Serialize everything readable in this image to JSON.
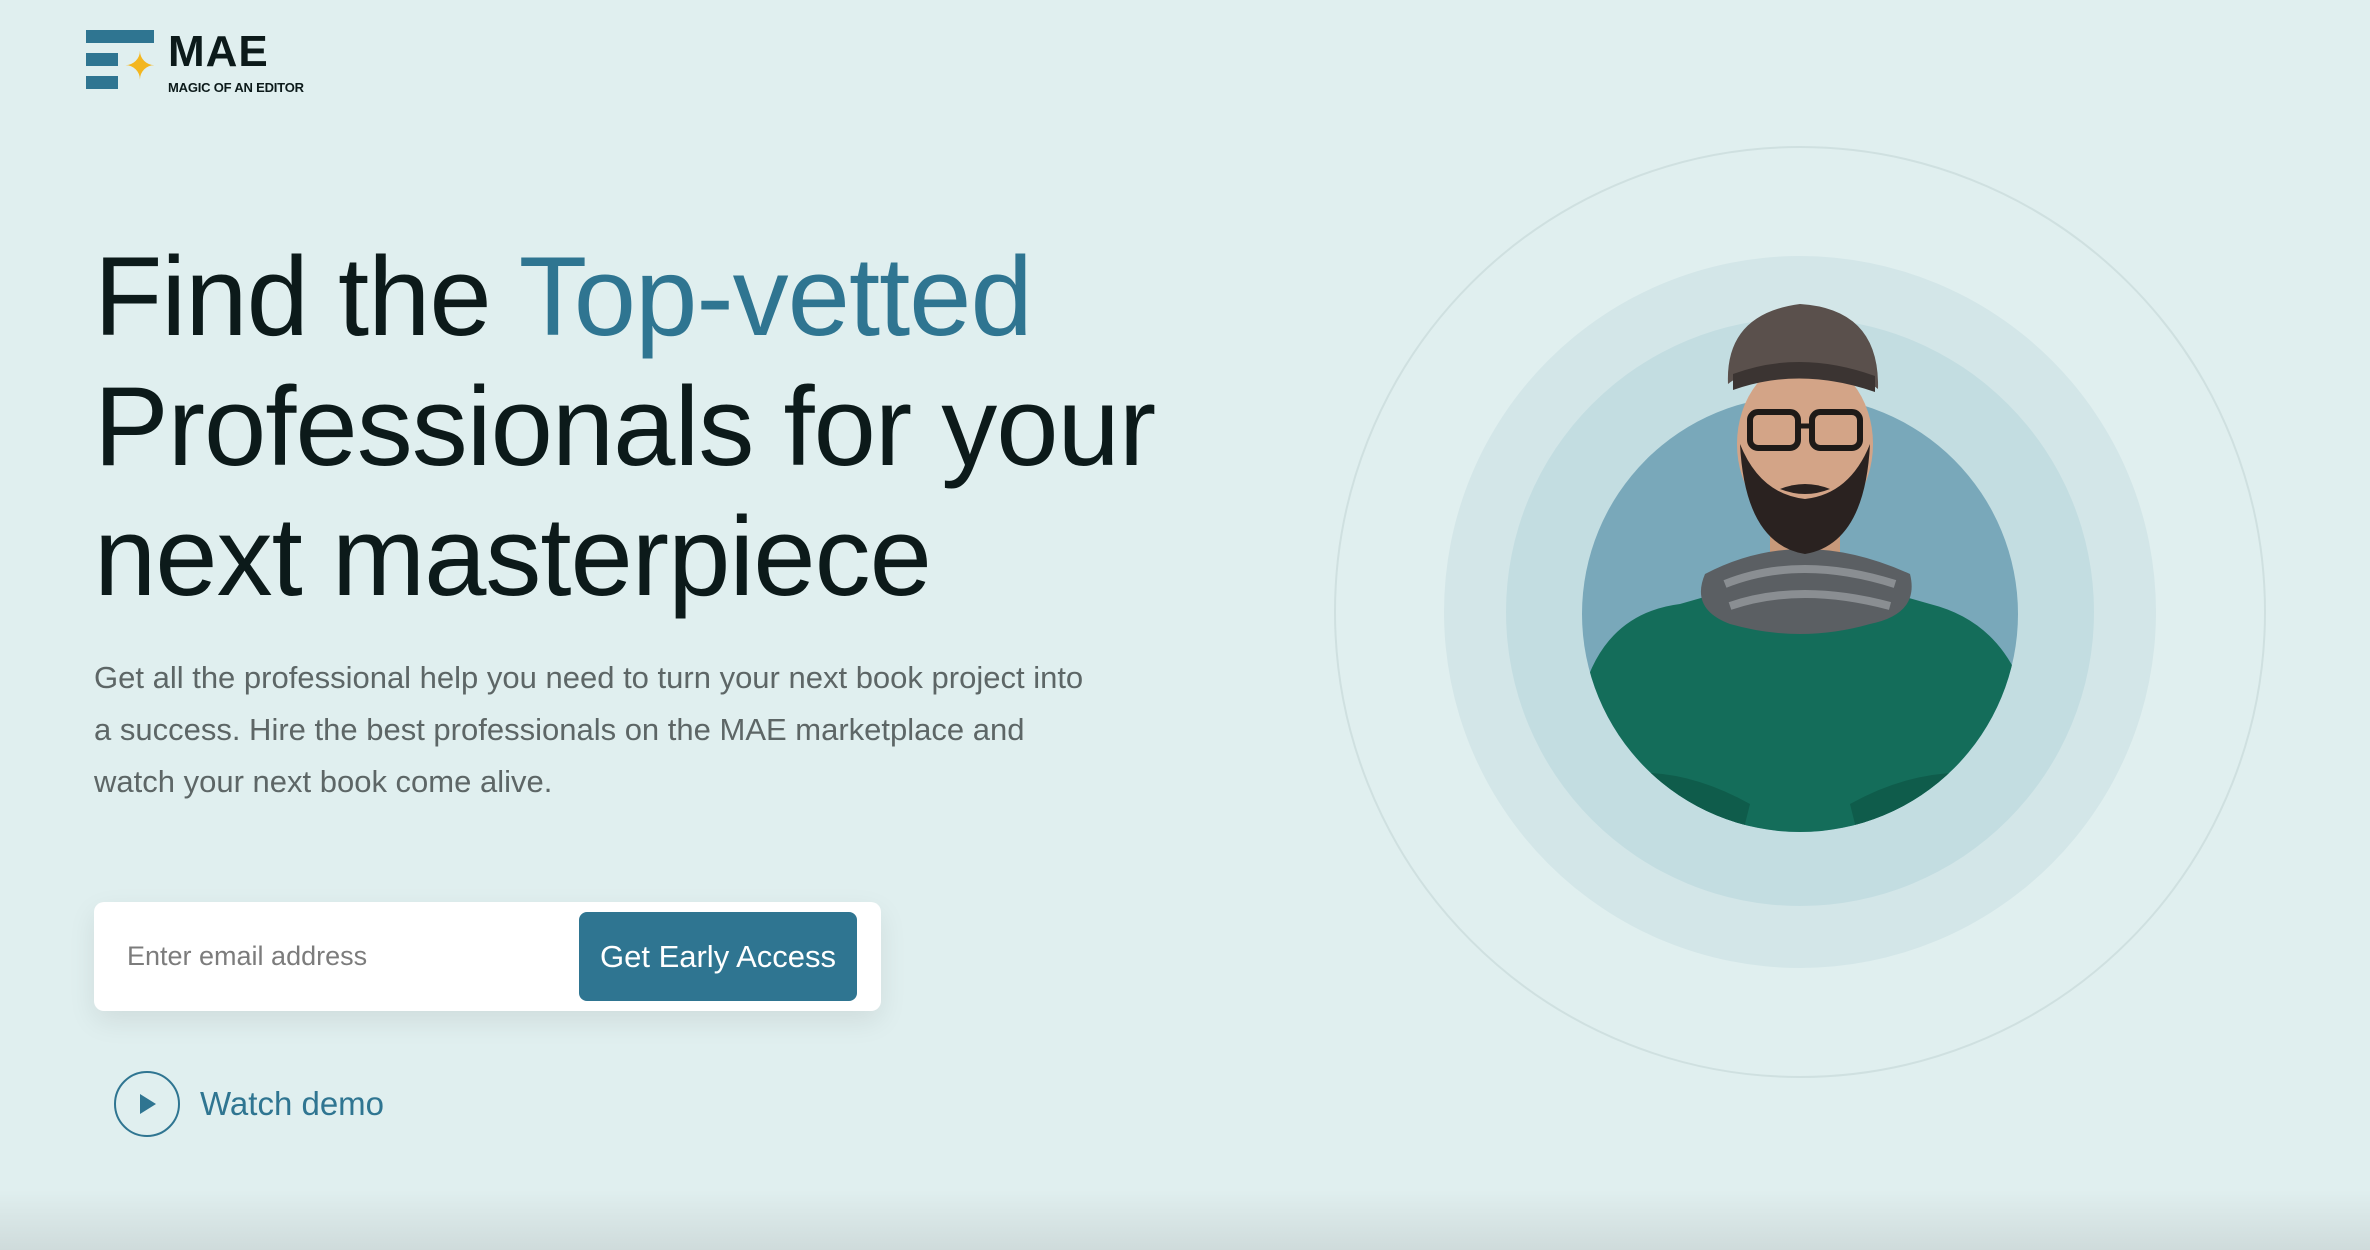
{
  "brand": {
    "name": "MAE",
    "tagline": "MAGIC OF AN EDITOR",
    "logo_icon": "stacked-bars-with-sparkle",
    "accent_color": "#2f7591",
    "star_color": "#f3b61f"
  },
  "hero": {
    "headline_pre": "Find the ",
    "headline_accent": "Top-vetted",
    "headline_post": "Professionals for your next masterpiece",
    "subtext": "Get all the professional help you need to turn your next book project into a success. Hire the best professionals on the MAE marketplace and watch your next book come alive.",
    "image_icon": "smiling-bearded-man-portrait"
  },
  "signup": {
    "email_placeholder": "Enter email address",
    "email_value": "",
    "button_label": "Get Early Access"
  },
  "demo": {
    "label": "Watch demo",
    "icon": "play-icon"
  },
  "colors": {
    "background": "#e0efef",
    "heading": "#0c1a1a",
    "body_text": "#5d6666",
    "button": "#2f7591"
  }
}
